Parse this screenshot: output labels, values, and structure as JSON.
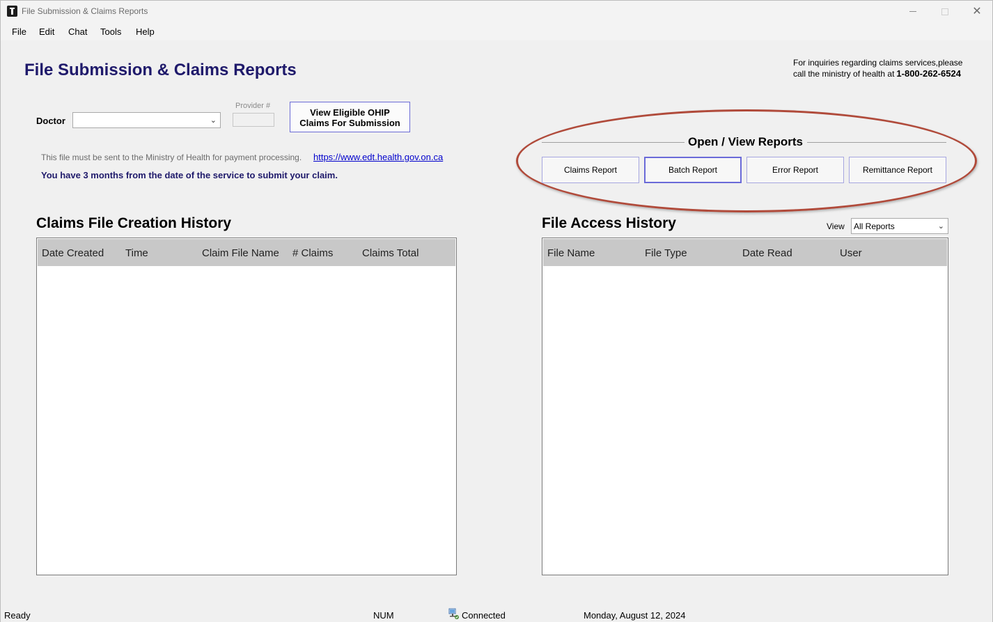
{
  "window": {
    "title": "File Submission & Claims Reports"
  },
  "menu": {
    "items": [
      "File",
      "Edit",
      "Chat",
      "Tools",
      "Help"
    ]
  },
  "header": {
    "title": "File Submission & Claims Reports",
    "inquiry_line1": "For inquiries regarding claims services,please",
    "inquiry_line2": "call the ministry of health at",
    "phone": "1-800-262-6524"
  },
  "form": {
    "doctor_label": "Doctor",
    "doctor_value": "",
    "provider_label": "Provider #",
    "provider_value": "",
    "ohip_button_line1": "View Eligible OHIP",
    "ohip_button_line2": "Claims For Submission"
  },
  "info": {
    "payment_note": "This file must be sent to the Ministry of Health for payment processing.",
    "link": "https://www.edt.health.gov.on.ca",
    "deadline": "You have 3 months from the date of the service to submit your claim."
  },
  "reports": {
    "title": "Open / View Reports",
    "buttons": [
      "Claims Report",
      "Batch Report",
      "Error Report",
      "Remittance Report"
    ]
  },
  "claims_history": {
    "title": "Claims File Creation History",
    "columns": [
      "Date Created",
      "Time",
      "Claim File Name",
      "# Claims",
      "Claims Total"
    ],
    "rows": []
  },
  "access_history": {
    "title": "File Access History",
    "view_label": "View",
    "view_value": "All Reports",
    "columns": [
      "File Name",
      "File Type",
      "Date Read",
      "User"
    ],
    "rows": []
  },
  "status": {
    "state": "Ready",
    "num": "NUM",
    "connection": "Connected",
    "date": "Monday, August 12, 2024"
  },
  "colors": {
    "title_navy": "#1f1a6b",
    "oval": "#b04a3a",
    "button_border": "#6b6bd6",
    "link": "#0000cc"
  }
}
